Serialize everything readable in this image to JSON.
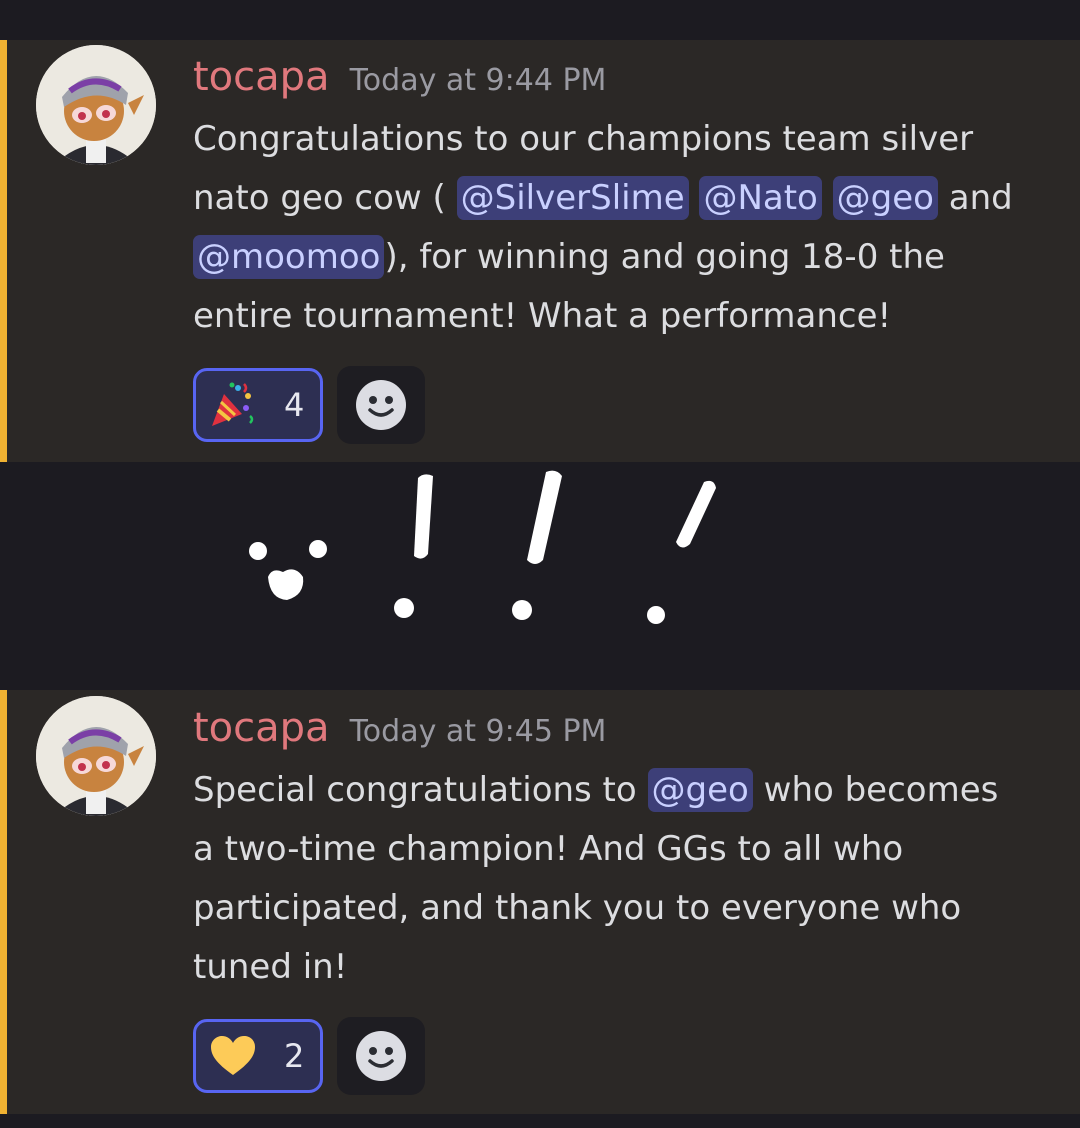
{
  "messages": [
    {
      "author": "tocapa",
      "timestamp": "Today at 9:44 PM",
      "text": {
        "p1": "Congratulations to our champions team silver",
        "p2": "nato geo cow ( ",
        "m1": "@SilverSlime",
        "m2": "@Nato",
        "m3": "@geo",
        "p3": " and",
        "m4": "@moomoo",
        "p4": "), for winning and going 18-0 the",
        "p5": "entire tournament! What a performance!"
      },
      "reaction": {
        "emoji": "party-popper",
        "count": "4"
      }
    },
    {
      "author": "tocapa",
      "timestamp": "Today at 9:45 PM",
      "text": {
        "p1": "Special congratulations to ",
        "m1": "@geo",
        "p2": " who becomes",
        "p3": "a two-time champion! And GGs to all who",
        "p4": "participated, and thank you to everyone who",
        "p5": "tuned in!"
      },
      "reaction": {
        "emoji": "yellow-heart",
        "count": "2"
      }
    }
  ],
  "colors": {
    "accent_bar": "#f0b232",
    "author": "#e0787d",
    "mention_bg": "#3d3f78",
    "reaction_border": "#5865f2"
  }
}
